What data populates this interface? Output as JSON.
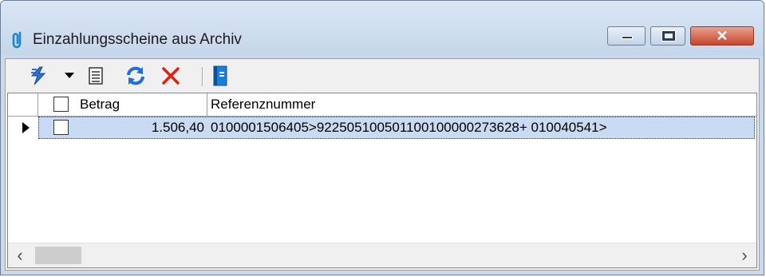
{
  "window": {
    "title": "Einzahlungsscheine aus Archiv",
    "close_glyph": "✕"
  },
  "toolbar": {
    "icons": [
      "lightning-icon",
      "dropdown-arrow-icon",
      "list-icon",
      "refresh-icon",
      "delete-icon",
      "book-icon"
    ]
  },
  "grid": {
    "columns": [
      "Betrag",
      "Referenznummer"
    ],
    "rows": [
      {
        "selected": true,
        "checked": false,
        "betrag": "1.506,40",
        "referenznummer": "0100001506405>922505100501100100000273628+ 010040541>"
      }
    ]
  },
  "scrollbar": {
    "left_arrow": "‹",
    "right_arrow": "›"
  },
  "colors": {
    "selection": "#c8dbf2",
    "delete": "#e02010",
    "refresh": "#1f6fd6",
    "lightning": "#2b6fd0"
  }
}
